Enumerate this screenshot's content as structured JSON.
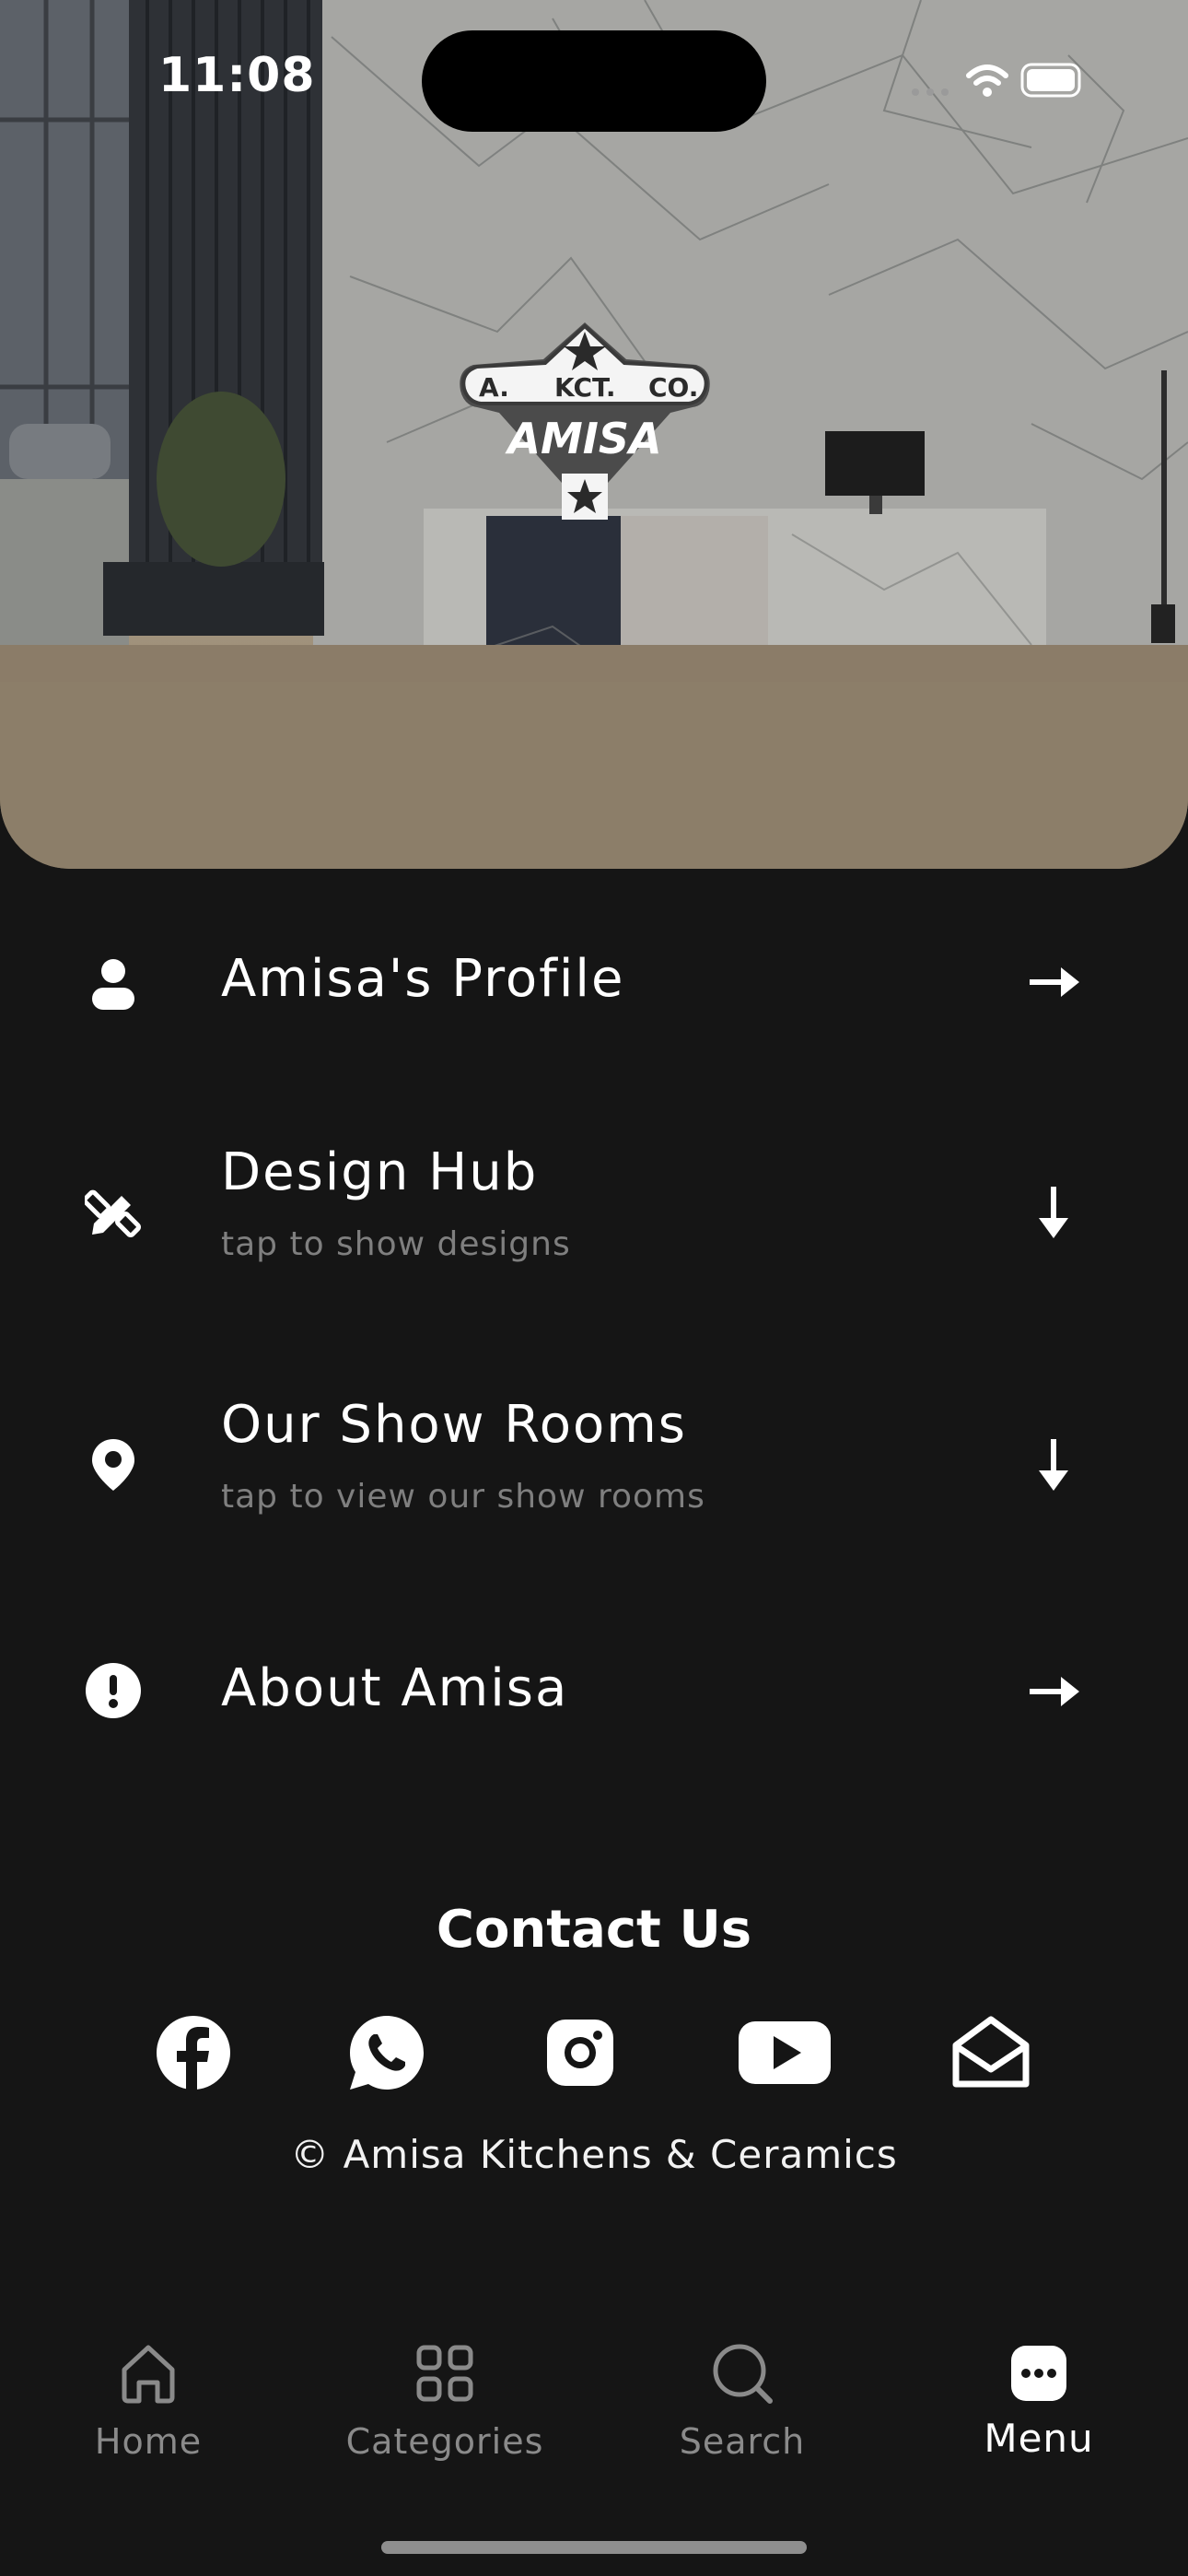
{
  "status_bar": {
    "time": "11:08"
  },
  "hero": {
    "logo": {
      "top_line": [
        "A.",
        "KCT.",
        "CO."
      ],
      "brand": "AMISA"
    }
  },
  "menu": [
    {
      "title": "Amisa's Profile",
      "subtitle": "",
      "icon": "user-icon",
      "arrow": "arrow-right"
    },
    {
      "title": "Design Hub",
      "subtitle": "tap to show designs",
      "icon": "pencil-ruler-icon",
      "arrow": "arrow-down"
    },
    {
      "title": "Our Show Rooms",
      "subtitle": "tap to view our show rooms",
      "icon": "location-pin-icon",
      "arrow": "arrow-down"
    },
    {
      "title": "About Amisa",
      "subtitle": "",
      "icon": "exclamation-circle-icon",
      "arrow": "arrow-right"
    }
  ],
  "contact": {
    "title": "Contact Us",
    "socials": [
      "facebook-icon",
      "whatsapp-icon",
      "instagram-icon",
      "youtube-icon",
      "mail-icon"
    ],
    "copyright": "© Amisa Kitchens & Ceramics"
  },
  "tabs": [
    {
      "label": "Home",
      "icon": "home-icon",
      "active": false
    },
    {
      "label": "Categories",
      "icon": "grid-icon",
      "active": false
    },
    {
      "label": "Search",
      "icon": "search-icon",
      "active": false
    },
    {
      "label": "Menu",
      "icon": "menu-dots-icon",
      "active": true
    }
  ],
  "colors": {
    "background": "#151515",
    "text": "#ffffff",
    "muted": "#7f7f7f",
    "tab_inactive": "#8a8a8a"
  }
}
